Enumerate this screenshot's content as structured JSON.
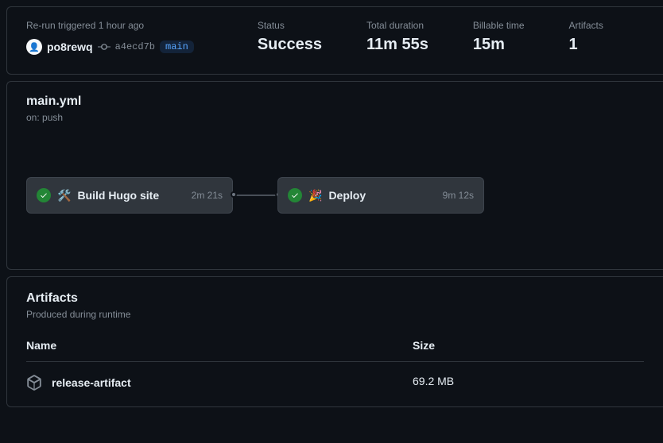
{
  "summary": {
    "trigger_text": "Re-run triggered 1 hour ago",
    "username": "po8rewq",
    "sha": "a4ecd7b",
    "branch": "main",
    "status_label": "Status",
    "status_value": "Success",
    "duration_label": "Total duration",
    "duration_value": "11m 55s",
    "billable_label": "Billable time",
    "billable_value": "15m",
    "artifacts_label": "Artifacts",
    "artifacts_value": "1"
  },
  "workflow": {
    "file": "main.yml",
    "trigger": "on: push",
    "jobs": [
      {
        "emoji": "🛠️",
        "name": "Build Hugo site",
        "duration": "2m 21s",
        "status": "success"
      },
      {
        "emoji": "🎉",
        "name": "Deploy",
        "duration": "9m 12s",
        "status": "success"
      }
    ]
  },
  "artifacts": {
    "title": "Artifacts",
    "subtitle": "Produced during runtime",
    "columns": {
      "name": "Name",
      "size": "Size"
    },
    "items": [
      {
        "name": "release-artifact",
        "size": "69.2 MB"
      }
    ]
  }
}
